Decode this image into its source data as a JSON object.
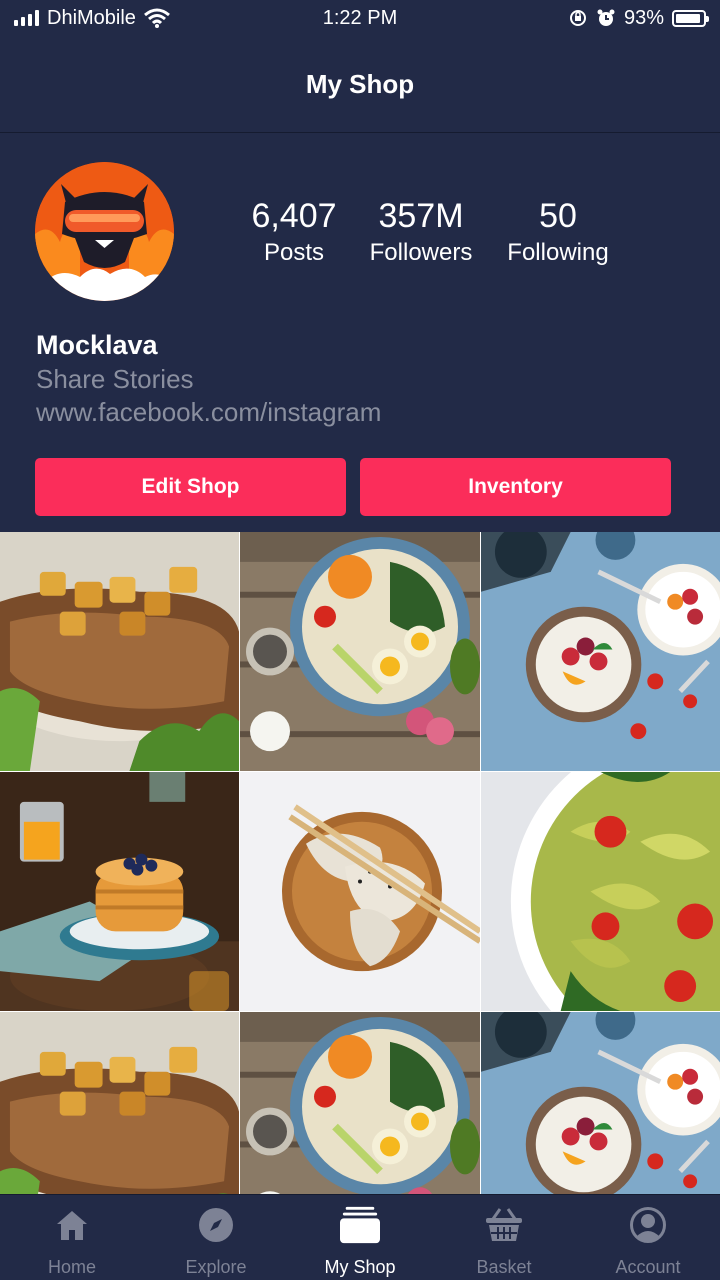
{
  "status_bar": {
    "carrier": "DhiMobile",
    "time": "1:22 PM",
    "battery": "93%",
    "battery_level": 0.93
  },
  "nav": {
    "title": "My Shop"
  },
  "profile": {
    "name": "Mocklava",
    "tagline": "Share Stories",
    "link": "www.facebook.com/instagram",
    "stats": [
      {
        "value": "6,407",
        "label": "Posts"
      },
      {
        "value": "357M",
        "label": "Followers"
      },
      {
        "value": "50",
        "label": "Following"
      }
    ],
    "accent_color": "#fb2d5a"
  },
  "actions": {
    "edit_label": "Edit Shop",
    "inventory_label": "Inventory"
  },
  "grid": {
    "tiles": [
      "pork-chop-with-apples",
      "salad-bowl-with-eggs",
      "yogurt-fruit-bowl",
      "blueberry-pancakes",
      "dumplings-on-wooden-plate",
      "pesto-farfalle-pasta",
      "pork-chop-with-apples",
      "salad-bowl-with-eggs",
      "yogurt-fruit-bowl"
    ]
  },
  "tabs": [
    {
      "label": "Home",
      "icon": "home-icon",
      "active": false
    },
    {
      "label": "Explore",
      "icon": "compass-icon",
      "active": false
    },
    {
      "label": "My Shop",
      "icon": "shop-icon",
      "active": true
    },
    {
      "label": "Basket",
      "icon": "basket-icon",
      "active": false
    },
    {
      "label": "Account",
      "icon": "account-icon",
      "active": false
    }
  ]
}
